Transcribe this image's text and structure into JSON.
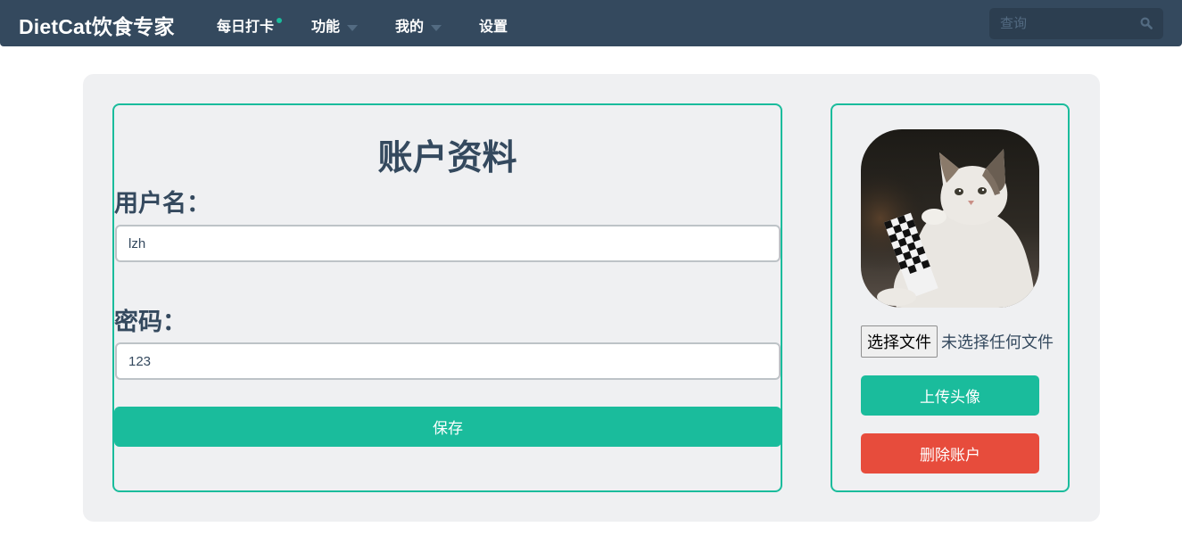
{
  "navbar": {
    "brand": "DietCat饮食专家",
    "items": [
      {
        "label": "每日打卡",
        "has_dot": true
      },
      {
        "label": "功能",
        "has_caret": true
      },
      {
        "label": "我的",
        "has_caret": true
      },
      {
        "label": "设置"
      }
    ],
    "search": {
      "placeholder": "查询",
      "icon": "search-icon"
    }
  },
  "account_form": {
    "title": "账户资料",
    "username_label": "用户名：",
    "username_value": "lzh",
    "password_label": "密码：",
    "password_value": "123",
    "save_label": "保存"
  },
  "avatar_card": {
    "file_button_label": "选择文件",
    "file_status": "未选择任何文件",
    "upload_label": "上传头像",
    "delete_label": "删除账户"
  },
  "colors": {
    "navbar": "#34495e",
    "accent": "#1abc9c",
    "danger": "#e74c3c",
    "panel": "#eff0f2"
  }
}
